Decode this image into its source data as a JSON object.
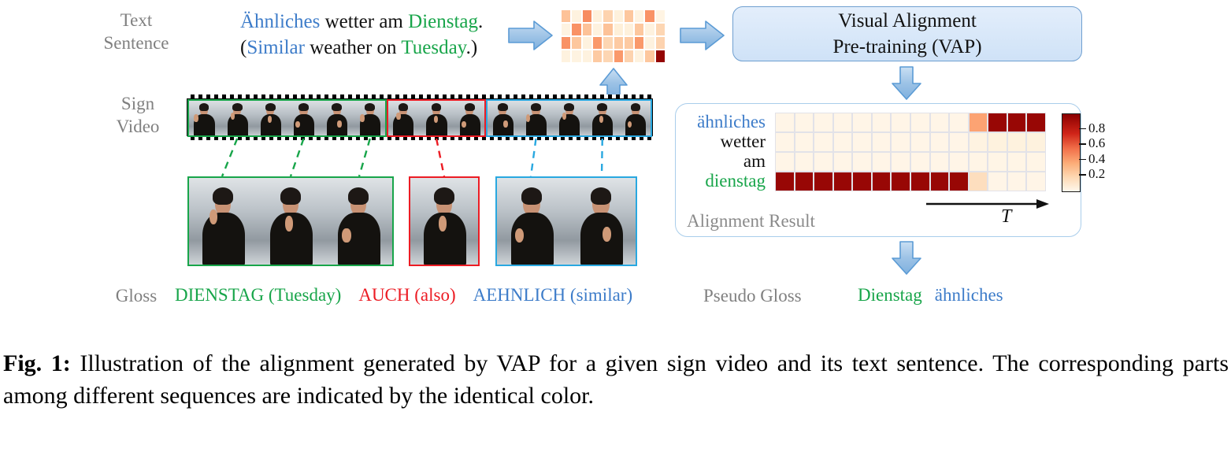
{
  "figure": {
    "caption_prefix": "Fig. 1:",
    "caption_text": " Illustration of the alignment generated by VAP for a given sign video and its text sentence. The corresponding parts among different sequences are indicated by the identical color."
  },
  "colors": {
    "blue": "#3d7cc9",
    "green": "#18a54a",
    "red": "#ec1c24",
    "gray_label": "#808080",
    "arrow_blue": "#9dc3e6",
    "box_fill": "#d6e6f8",
    "box_border": "#6f9fd0",
    "heat_max": "#8b0000",
    "heat_min": "#fff7ec"
  },
  "left": {
    "text_sentence_label": "Text\nSentence",
    "text_sentence_label_line1": "Text",
    "text_sentence_label_line2": "Sentence",
    "sentence_line1": [
      {
        "t": "Ähnliches",
        "c": "blue"
      },
      {
        "t": " wetter am ",
        "c": "black"
      },
      {
        "t": "Dienstag",
        "c": "green"
      },
      {
        "t": ".",
        "c": "black"
      }
    ],
    "sentence_line2": [
      {
        "t": "(",
        "c": "black"
      },
      {
        "t": "Similar",
        "c": "blue"
      },
      {
        "t": " weather on ",
        "c": "black"
      },
      {
        "t": "Tuesday",
        "c": "green"
      },
      {
        "t": ".)",
        "c": "black"
      }
    ],
    "sign_video_label_line1": "Sign",
    "sign_video_label_line2": "Video",
    "gloss_label": "Gloss",
    "glosses": [
      {
        "text": "DIENSTAG (Tuesday)",
        "color": "green"
      },
      {
        "text": "AUCH (also)",
        "color": "red"
      },
      {
        "text": "AEHNLICH (similar)",
        "color": "blue"
      }
    ],
    "frame_groups": [
      {
        "color": "green",
        "frames": 6
      },
      {
        "color": "red",
        "frames": 3
      },
      {
        "color": "blue",
        "frames": 5
      }
    ],
    "zoomed_groups": [
      {
        "color": "green",
        "frames": 3
      },
      {
        "color": "red",
        "frames": 1
      },
      {
        "color": "blue",
        "frames": 2
      }
    ]
  },
  "right": {
    "vap_box_line1": "Visual Alignment",
    "vap_box_line2": "Pre-training (VAP)",
    "alignment_result_label": "Alignment Result",
    "time_axis_label": "T",
    "pseudo_gloss_label": "Pseudo Gloss",
    "pseudo_glosses": [
      {
        "text": "Dienstag",
        "color": "green"
      },
      {
        "text": "ähnliches",
        "color": "blue"
      }
    ]
  },
  "chart_data": [
    {
      "type": "heatmap",
      "name": "text-embedding-minimap",
      "title": "",
      "rows": 4,
      "cols": 10,
      "vmin": 0,
      "vmax": 1,
      "colormap": "OrRd",
      "values": [
        [
          0.42,
          0.08,
          0.62,
          0.1,
          0.32,
          0.1,
          0.4,
          0.07,
          0.6,
          0.06
        ],
        [
          0.07,
          0.6,
          0.42,
          0.08,
          0.42,
          0.12,
          0.1,
          0.4,
          0.08,
          0.3
        ],
        [
          0.6,
          0.4,
          0.08,
          0.58,
          0.3,
          0.38,
          0.38,
          0.58,
          0.08,
          0.32
        ],
        [
          0.08,
          0.07,
          0.08,
          0.38,
          0.3,
          0.58,
          0.32,
          0.08,
          0.4,
          0.98
        ]
      ]
    },
    {
      "type": "heatmap",
      "name": "alignment-result",
      "title": "Alignment Result",
      "xlabel": "T",
      "rows": 4,
      "cols": 14,
      "vmin": 0,
      "vmax": 1,
      "colormap": "OrRd",
      "row_labels": [
        "ähnliches",
        "wetter",
        "am",
        "dienstag"
      ],
      "row_label_colors": [
        "blue",
        "black",
        "black",
        "green"
      ],
      "colorbar_ticks": [
        "0.8",
        "0.6",
        "0.4",
        "0.2"
      ],
      "colorbar_tick_values": [
        0.8,
        0.6,
        0.4,
        0.2
      ],
      "values": [
        [
          0.03,
          0.03,
          0.03,
          0.03,
          0.03,
          0.03,
          0.03,
          0.03,
          0.03,
          0.03,
          0.55,
          0.97,
          0.97,
          0.97
        ],
        [
          0.03,
          0.03,
          0.03,
          0.03,
          0.03,
          0.03,
          0.03,
          0.03,
          0.03,
          0.03,
          0.07,
          0.09,
          0.09,
          0.09
        ],
        [
          0.03,
          0.03,
          0.03,
          0.03,
          0.03,
          0.03,
          0.03,
          0.03,
          0.03,
          0.03,
          0.04,
          0.04,
          0.04,
          0.04
        ],
        [
          0.97,
          0.97,
          0.97,
          0.97,
          0.97,
          0.97,
          0.97,
          0.97,
          0.97,
          0.97,
          0.25,
          0.03,
          0.03,
          0.03
        ]
      ]
    }
  ]
}
